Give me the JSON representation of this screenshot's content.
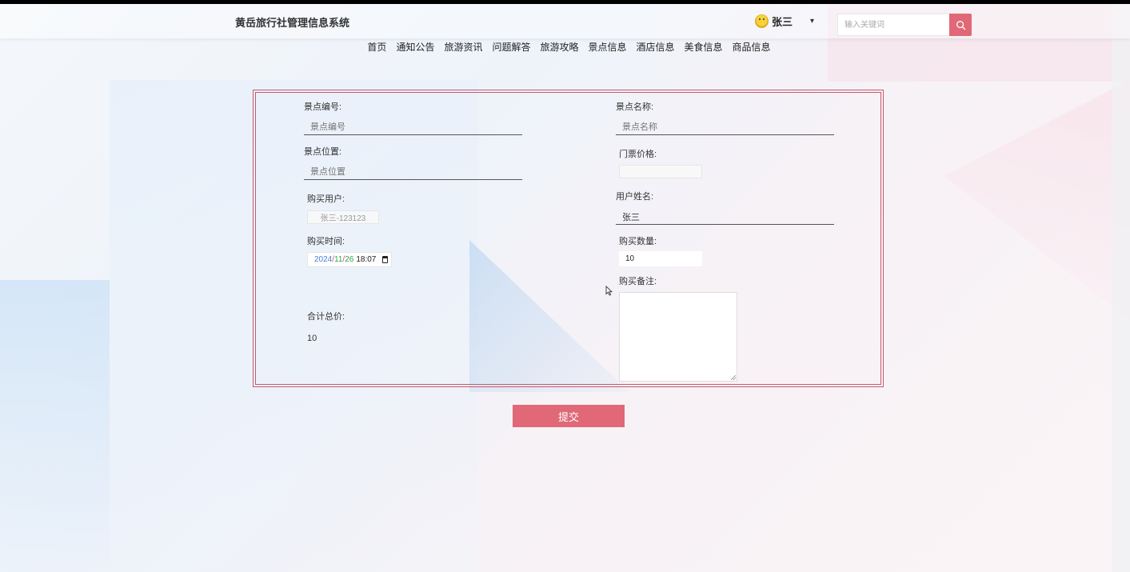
{
  "header": {
    "site_title": "黄岳旅行社管理信息系统",
    "user_name": "张三",
    "caret": "▾",
    "search_placeholder": "输入关键词"
  },
  "nav": {
    "items": [
      "首页",
      "通知公告",
      "旅游资讯",
      "问题解答",
      "旅游攻略",
      "景点信息",
      "酒店信息",
      "美食信息",
      "商品信息"
    ]
  },
  "form": {
    "scenic_no_label": "景点编号:",
    "scenic_no_placeholder": "景点编号",
    "scenic_name_label": "景点名称:",
    "scenic_name_placeholder": "景点名称",
    "scenic_location_label": "景点位置:",
    "scenic_location_placeholder": "景点位置",
    "ticket_price_label": "门票价格:",
    "ticket_price_value": "",
    "buyer_label": "购买用户:",
    "buyer_value": "张三-123123",
    "user_name_label": "用户姓名:",
    "user_name_value": "张三",
    "purchase_time_label": "购买时间:",
    "purchase_date_year": "2024",
    "purchase_date_month": "11",
    "purchase_date_day": "26",
    "purchase_time": "18:07",
    "quantity_label": "购买数量:",
    "quantity_value": "10",
    "remark_label": "购买备注:",
    "remark_value": "",
    "total_label": "合计总价:",
    "total_value": "10",
    "submit_label": "提交"
  },
  "colors": {
    "accent": "#e06877",
    "frame": "#c85a6c"
  }
}
